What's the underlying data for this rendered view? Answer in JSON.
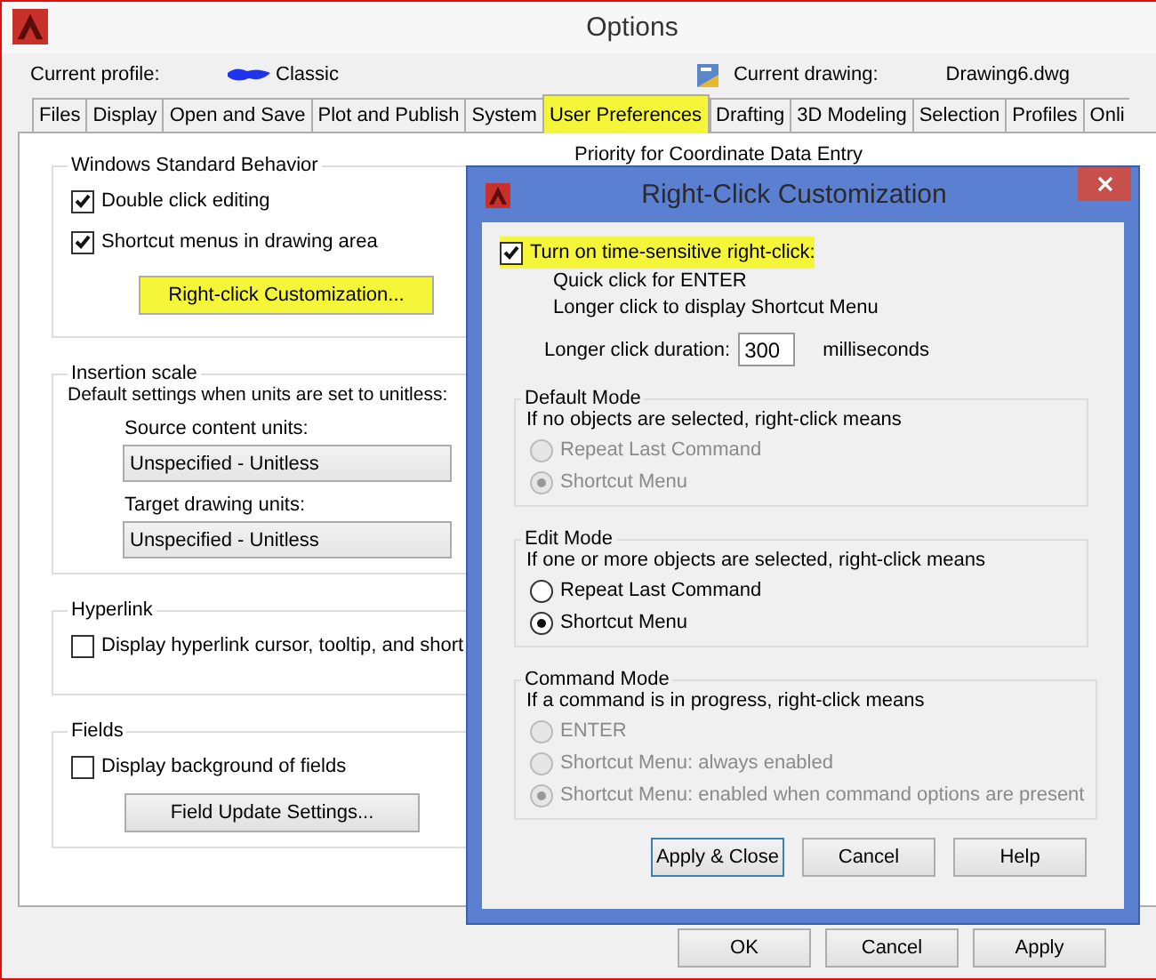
{
  "window": {
    "title": "Options"
  },
  "profile": {
    "label": "Current profile:",
    "value": "Classic"
  },
  "drawing": {
    "label": "Current drawing:",
    "value": "Drawing6.dwg"
  },
  "tabs": [
    {
      "label": "Files",
      "selected": false,
      "highlighted": false
    },
    {
      "label": "Display",
      "selected": false,
      "highlighted": false
    },
    {
      "label": "Open and Save",
      "selected": false,
      "highlighted": false
    },
    {
      "label": "Plot and Publish",
      "selected": false,
      "highlighted": false
    },
    {
      "label": "System",
      "selected": false,
      "highlighted": false
    },
    {
      "label": "User Preferences",
      "selected": true,
      "highlighted": true
    },
    {
      "label": "Drafting",
      "selected": false,
      "highlighted": false
    },
    {
      "label": "3D Modeling",
      "selected": false,
      "highlighted": false
    },
    {
      "label": "Selection",
      "selected": false,
      "highlighted": false
    },
    {
      "label": "Profiles",
      "selected": false,
      "highlighted": false
    },
    {
      "label": "Onli",
      "selected": false,
      "highlighted": false
    }
  ],
  "groups": [
    {
      "kind": "checks",
      "title": "Windows Standard Behavior",
      "checkboxes": [
        {
          "label": "Double click editing",
          "checked": true
        },
        {
          "label": "Shortcut menus in drawing area",
          "checked": true
        }
      ],
      "button": {
        "label": "Right-click Customization...",
        "highlighted": true
      }
    },
    {
      "kind": "units",
      "title": "Insertion scale",
      "description": "Default settings when units are set to unitless:",
      "fields": [
        {
          "label": "Source content units:",
          "value": "Unspecified - Unitless"
        },
        {
          "label": "Target drawing units:",
          "value": "Unspecified - Unitless"
        }
      ]
    },
    {
      "kind": "checks",
      "title": "Hyperlink",
      "checkboxes": [
        {
          "label": "Display hyperlink cursor, tooltip, and short",
          "checked": false
        }
      ]
    },
    {
      "kind": "checks",
      "title": "Fields",
      "checkboxes": [
        {
          "label": "Display background of fields",
          "checked": false
        }
      ],
      "button": {
        "label": "Field Update Settings...",
        "highlighted": false
      }
    }
  ],
  "right_column": {
    "heading": "Priority for Coordinate Data Entry"
  },
  "footer_buttons": [
    "OK",
    "Cancel",
    "Apply"
  ],
  "dialog": {
    "title": "Right-Click Customization",
    "time_sensitive": {
      "label": "Turn on time-sensitive right-click:",
      "checked": true,
      "highlighted": true
    },
    "lines": [
      "Quick click for ENTER",
      "Longer click to display Shortcut Menu"
    ],
    "duration": {
      "label": "Longer click duration:",
      "value": "300",
      "unit": "milliseconds"
    },
    "modes": [
      {
        "title": "Default Mode",
        "description": "If no objects are selected, right-click means",
        "options": [
          {
            "label": "Repeat Last Command",
            "selected": false,
            "disabled": true
          },
          {
            "label": "Shortcut Menu",
            "selected": true,
            "disabled": true
          }
        ]
      },
      {
        "title": "Edit Mode",
        "description": "If one or more objects are selected, right-click means",
        "options": [
          {
            "label": "Repeat Last Command",
            "selected": false,
            "disabled": false
          },
          {
            "label": "Shortcut Menu",
            "selected": true,
            "disabled": false
          }
        ]
      },
      {
        "title": "Command Mode",
        "description": "If a command is in progress, right-click means",
        "options": [
          {
            "label": "ENTER",
            "selected": false,
            "disabled": true
          },
          {
            "label": "Shortcut Menu: always enabled",
            "selected": false,
            "disabled": true
          },
          {
            "label": "Shortcut Menu: enabled when command options are present",
            "selected": true,
            "disabled": true
          }
        ]
      }
    ],
    "buttons": [
      {
        "label": "Apply & Close",
        "default": true
      },
      {
        "label": "Cancel",
        "default": false
      },
      {
        "label": "Help",
        "default": false
      }
    ]
  }
}
